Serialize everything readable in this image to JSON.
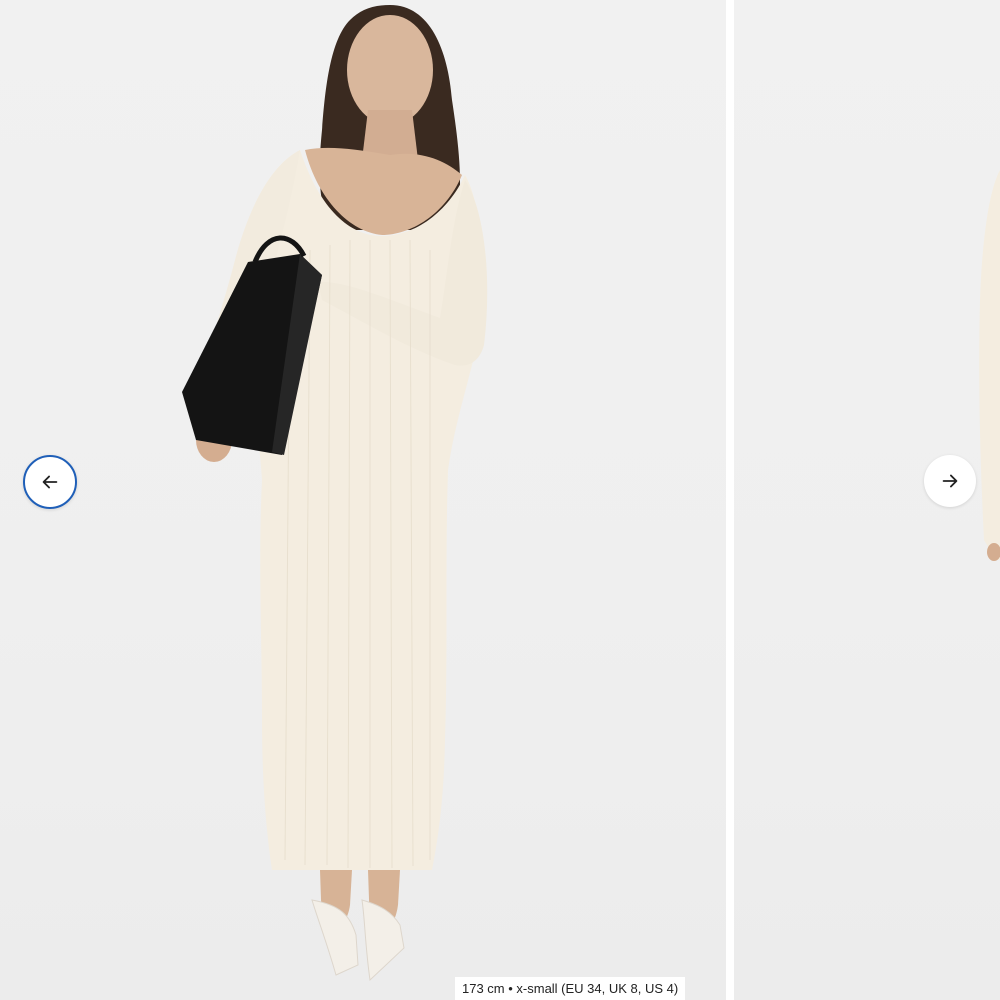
{
  "gallery": {
    "caption": "173 cm • x-small (EU 34, UK 8, US 4)",
    "prev_icon": "arrow-left-icon",
    "next_icon": "arrow-right-icon",
    "colors": {
      "background": "#efefef",
      "dress": "#f4ede0",
      "bag": "#141414",
      "focus_ring": "#1f5fb8"
    }
  }
}
